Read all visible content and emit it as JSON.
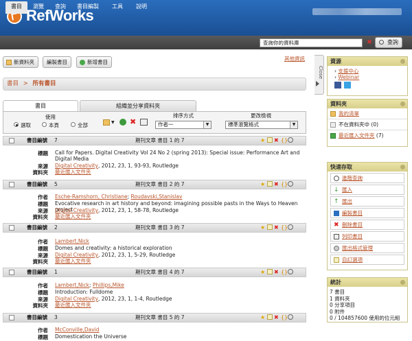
{
  "header": {
    "app_name": "RefWorks"
  },
  "nav": {
    "items": [
      "書目",
      "瀏覽",
      "查詢",
      "書目編製",
      "工具",
      "說明"
    ]
  },
  "search": {
    "placeholder": "查詢你的資料庫",
    "button": "查詢"
  },
  "toolbar": {
    "new_folder": "新資料夾",
    "create_bib": "編製書目",
    "new_ref": "新增書目",
    "other_info": "其他資訊"
  },
  "breadcrumb": {
    "root": "書目",
    "sep": ">",
    "current": "所有書目"
  },
  "close_tab": "Close",
  "tabs": {
    "refs": "書目",
    "organize": "組織並分享資料夾"
  },
  "controls": {
    "use_label": "使用",
    "radios": [
      "選取",
      "本頁",
      "全部"
    ],
    "sort_label": "排序方式",
    "sort_value": "作者一",
    "view_label": "更改檢視",
    "view_value": "標準瀏覽格式"
  },
  "references": [
    {
      "id_label": "書目編號",
      "id": "7",
      "type": "期刊文章 書目 1 的 7",
      "fields": [
        {
          "label": "標題",
          "value": "Call for Papers. Digital Creativity Vol 24 No 2 (spring 2013): Special issue: Performance Art and Digital Media",
          "link": false
        },
        {
          "label": "來源",
          "link_text": "Digital Creativity",
          "value": ", 2012, 23, 1, 93-93, Routledge",
          "link": true
        },
        {
          "label": "資料夾",
          "value": "最近匯入文件夾",
          "link": true
        }
      ]
    },
    {
      "id_label": "書目編號",
      "id": "5",
      "type": "期刊文章 書目 2 的 7",
      "fields": [
        {
          "label": "作者",
          "authors": [
            "Esche-Ramshorn, Christiane",
            "Roudavski,Stanislav"
          ]
        },
        {
          "label": "標題",
          "value": "Evocative research in art history and beyond: imagining possible pasts in the Ways to Heaven project",
          "link": false
        },
        {
          "label": "來源",
          "link_text": "Digital Creativity",
          "value": ", 2012, 23, 1, 58-78, Routledge",
          "link": true
        },
        {
          "label": "資料夾",
          "value": "最近匯入文件夾",
          "link": true
        }
      ]
    },
    {
      "id_label": "書目編號",
      "id": "2",
      "type": "期刊文章 書目 3 的 7",
      "fields": [
        {
          "label": "作者",
          "authors": [
            "Lambert,Nick"
          ]
        },
        {
          "label": "標題",
          "value": "Domes and creativity: a historical exploration",
          "link": false
        },
        {
          "label": "來源",
          "link_text": "Digital Creativity",
          "value": ", 2012, 23, 1, 5-29, Routledge",
          "link": true
        },
        {
          "label": "資料夾",
          "value": "最近匯入文件夾",
          "link": true
        }
      ]
    },
    {
      "id_label": "書目編號",
      "id": "1",
      "type": "期刊文章 書目 4 的 7",
      "fields": [
        {
          "label": "作者",
          "authors": [
            "Lambert,Nick",
            "Phillips,Mike"
          ]
        },
        {
          "label": "標題",
          "value": "Introduction: Fulldome",
          "link": false
        },
        {
          "label": "來源",
          "link_text": "Digital Creativity",
          "value": ", 2012, 23, 1, 1-4, Routledge",
          "link": true
        },
        {
          "label": "資料夾",
          "value": "最近匯入文件夾",
          "link": true
        }
      ]
    },
    {
      "id_label": "書目編號",
      "id": "3",
      "type": "期刊文章 書目 5 的 7",
      "fields": [
        {
          "label": "作者",
          "authors": [
            "McConville,David"
          ]
        },
        {
          "label": "標題",
          "value": "Domestication the Universe",
          "link": false
        }
      ]
    }
  ],
  "sidebar": {
    "resources": {
      "title": "資源",
      "items": [
        "支援中心",
        "Webinar"
      ]
    },
    "folders": {
      "title": "資料夾",
      "items": [
        {
          "name": "我的清單",
          "count": ""
        },
        {
          "name": "不在資料夾中",
          "count": "(0)"
        },
        {
          "name": "最近匯入文件夾",
          "count": "(7)"
        }
      ]
    },
    "quick": {
      "title": "快速存取",
      "items": [
        "進階查詢",
        "匯入",
        "匯出",
        "編製書目",
        "刪除書目",
        "列印書目",
        "匯出格式管理",
        "自訂選項"
      ]
    },
    "stats": {
      "title": "統計",
      "lines": [
        "7 書目",
        "1 資料夾",
        "0 分享項目",
        "0 附件",
        "0 / 104857600 使用的位元組"
      ]
    }
  },
  "colors": {
    "brand_blue": "#1f5da8",
    "accent_orange": "#b9542a",
    "sidebar_header": "#dfd894"
  }
}
